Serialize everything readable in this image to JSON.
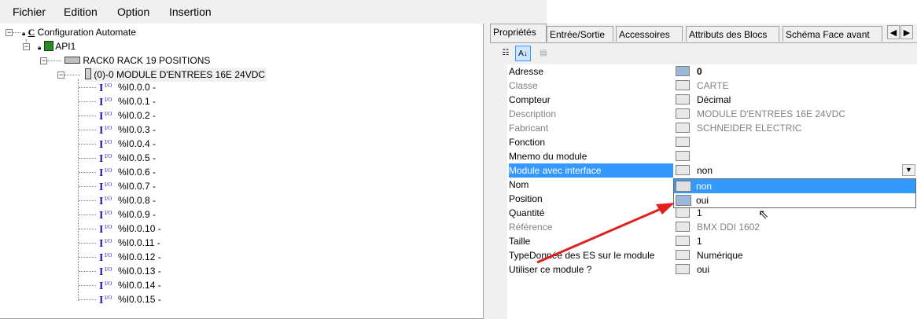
{
  "menu": [
    "Fichier",
    "Edition",
    "Option",
    "Insertion"
  ],
  "tree": {
    "root": "Configuration Automate",
    "api": "API1",
    "rack": "RACK0 RACK 19 POSITIONS",
    "module": "(0)-0 MODULE D'ENTREES 16E 24VDC",
    "io_items": [
      "%I0.0.0 -",
      "%I0.0.1 -",
      "%I0.0.2 -",
      "%I0.0.3 -",
      "%I0.0.4 -",
      "%I0.0.5 -",
      "%I0.0.6 -",
      "%I0.0.7 -",
      "%I0.0.8 -",
      "%I0.0.9 -",
      "%I0.0.10 -",
      "%I0.0.11 -",
      "%I0.0.12 -",
      "%I0.0.13 -",
      "%I0.0.14 -",
      "%I0.0.15 -"
    ]
  },
  "tabs": [
    "Propriétés",
    "Entrée/Sortie",
    "Accessoires",
    "Attributs des Blocs",
    "Schéma Face avant"
  ],
  "properties": [
    {
      "name": "Adresse",
      "value": "0",
      "disabled": false,
      "bold": true
    },
    {
      "name": "Classe",
      "value": "CARTE",
      "disabled": true
    },
    {
      "name": "Compteur",
      "value": "Décimal",
      "disabled": false
    },
    {
      "name": "Description",
      "value": "MODULE D'ENTREES 16E 24VDC",
      "disabled": true
    },
    {
      "name": "Fabricant",
      "value": "SCHNEIDER ELECTRIC",
      "disabled": true
    },
    {
      "name": "Fonction",
      "value": "",
      "disabled": false
    },
    {
      "name": "Mnemo du module",
      "value": "",
      "disabled": false
    },
    {
      "name": "Module avec interface",
      "value": "non",
      "disabled": false,
      "selected": true
    },
    {
      "name": "Nom",
      "value": "",
      "disabled": false
    },
    {
      "name": "Position",
      "value": "",
      "disabled": false
    },
    {
      "name": "Quantité",
      "value": "1",
      "disabled": false
    },
    {
      "name": "Référence",
      "value": "BMX DDI 1602",
      "disabled": true
    },
    {
      "name": "Taille",
      "value": "1",
      "disabled": false
    },
    {
      "name": "TypeDonnée des ES sur le module",
      "value": "Numérique",
      "disabled": false
    },
    {
      "name": "Utiliser ce module ?",
      "value": "oui",
      "disabled": false
    }
  ],
  "dropdown_options": [
    "non",
    "oui"
  ],
  "colors": {
    "selection": "#3399ff",
    "arrow": "#e02020",
    "tree_icon": "#1a1ab0"
  }
}
